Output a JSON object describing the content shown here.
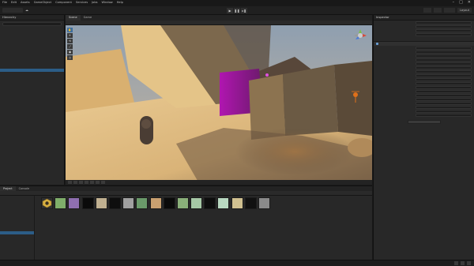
{
  "titlebar": {
    "menus": [
      "File",
      "Edit",
      "Assets",
      "GameObject",
      "Component",
      "Services",
      "Jobs",
      "Window",
      "Help"
    ],
    "title": "",
    "controls": [
      "–",
      "□",
      "✕"
    ]
  },
  "toolbar": {
    "account": "",
    "play_icons": [
      "▶",
      "❚❚",
      "▸❚"
    ],
    "right_buttons": [
      "",
      "",
      "",
      "Layout"
    ]
  },
  "hierarchy": {
    "tab": "Hierarchy",
    "search_placeholder": "",
    "items": [
      "",
      "",
      "",
      "",
      "",
      "",
      "",
      "",
      "",
      "",
      "",
      "",
      "",
      "",
      "",
      "",
      "",
      "",
      "",
      "",
      "",
      "",
      "",
      ""
    ]
  },
  "scene": {
    "tabs": [
      "Scene",
      "Game"
    ],
    "tools": [
      "✋",
      "✛",
      "⟲",
      "⤢",
      "▣",
      "◎"
    ],
    "bottom_label": ""
  },
  "inspector": {
    "tab": "Inspector",
    "rows": [
      {
        "lab": "",
        "val": ""
      },
      {
        "lab": "",
        "val": ""
      },
      {
        "lab": "",
        "val": ""
      },
      {
        "lab": "",
        "val": ""
      }
    ],
    "component_header": "",
    "component_rows": [
      {
        "lab": "",
        "val": ""
      },
      {
        "lab": "",
        "val": ""
      },
      {
        "lab": "",
        "val": ""
      },
      {
        "lab": "",
        "val": ""
      },
      {
        "lab": "",
        "val": ""
      },
      {
        "lab": "",
        "val": ""
      },
      {
        "lab": "",
        "val": ""
      },
      {
        "lab": "",
        "val": ""
      },
      {
        "lab": "",
        "val": ""
      },
      {
        "lab": "",
        "val": ""
      },
      {
        "lab": "",
        "val": ""
      },
      {
        "lab": "",
        "val": ""
      },
      {
        "lab": "",
        "val": ""
      },
      {
        "lab": "",
        "val": ""
      },
      {
        "lab": "",
        "val": ""
      },
      {
        "lab": "",
        "val": ""
      },
      {
        "lab": "",
        "val": ""
      },
      {
        "lab": "",
        "val": ""
      }
    ],
    "add_component": ""
  },
  "project": {
    "tabs": [
      "Project",
      "Console"
    ],
    "breadcrumb": "",
    "tree": [
      "",
      "",
      "",
      "",
      "",
      "",
      "",
      "",
      "",
      "",
      "",
      "",
      "",
      "",
      "",
      "",
      "",
      "",
      ""
    ],
    "asset_colors": [
      "#cca640",
      "#7fae6a",
      "#8f6fb0",
      "#0a0a0a",
      "#c0b090",
      "#0e0e0e",
      "#a0a0a0",
      "#6a9a6a",
      "#c9a070",
      "#0a0a0a",
      "#8ab07a",
      "#a6c8a6",
      "#0d0d0d",
      "#b8d8c0",
      "#d0c090",
      "#111111",
      "#8a8a8a"
    ]
  },
  "status": {
    "message": ""
  },
  "colors": {
    "accent": "#2c5d87",
    "magenta": "#c21fbf"
  }
}
